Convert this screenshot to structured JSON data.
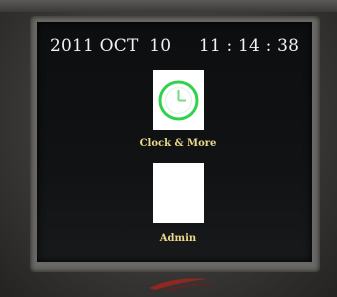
{
  "status": {
    "year": "2011",
    "month": "OCT",
    "day": "10",
    "time": "11 : 14 : 38"
  },
  "menu": {
    "items": [
      {
        "label": "Clock & More",
        "icon": "clock-icon"
      },
      {
        "label": "Admin",
        "icon": "blank-icon"
      }
    ]
  },
  "colors": {
    "screen_background": "#0e1012",
    "clock_text": "#f2f2f2",
    "menu_label": "#e9d98a",
    "tile": "#ffffff",
    "clock_icon_ring": "#2fd24a",
    "logo_accent": "#b0231f"
  }
}
